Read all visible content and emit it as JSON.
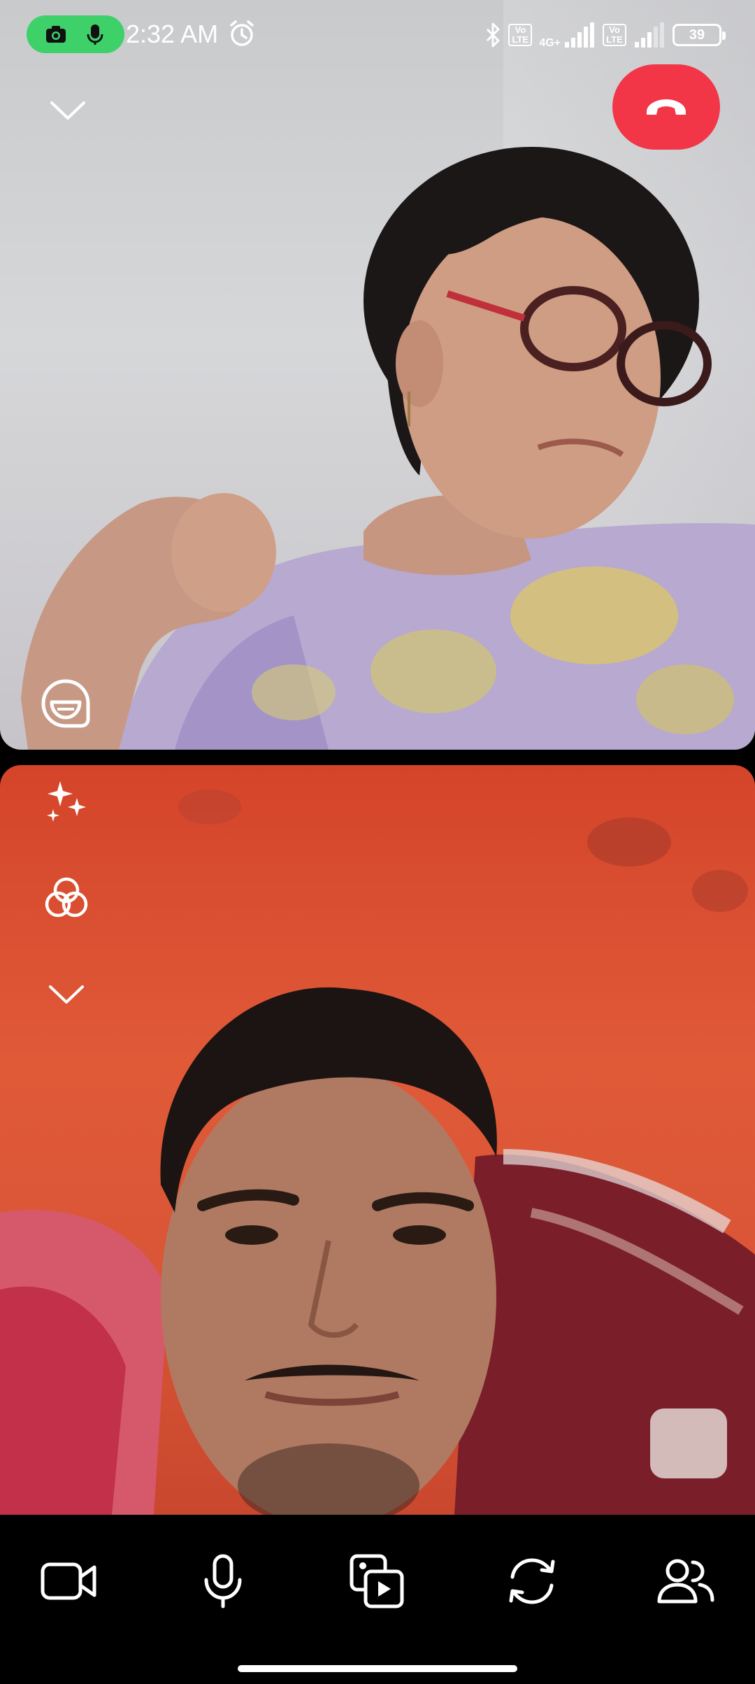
{
  "status_bar": {
    "time": "2:32 AM",
    "volte_label": "Vo\nLTE",
    "network_type": "4G+",
    "battery_level": "39",
    "privacy_indicator_color": "#3ed16a"
  },
  "call": {
    "end_call_color": "#f23648",
    "icons": {
      "collapse": "chevron-down-icon",
      "end_call": "phone-hangup-icon",
      "sticker": "sticker-icon",
      "effects": "sparkles-icon",
      "filters": "filters-icon",
      "more": "chevron-down-icon"
    }
  },
  "controls": {
    "icons": [
      "video-camera-icon",
      "microphone-icon",
      "media-share-icon",
      "switch-camera-icon",
      "participants-icon"
    ]
  }
}
